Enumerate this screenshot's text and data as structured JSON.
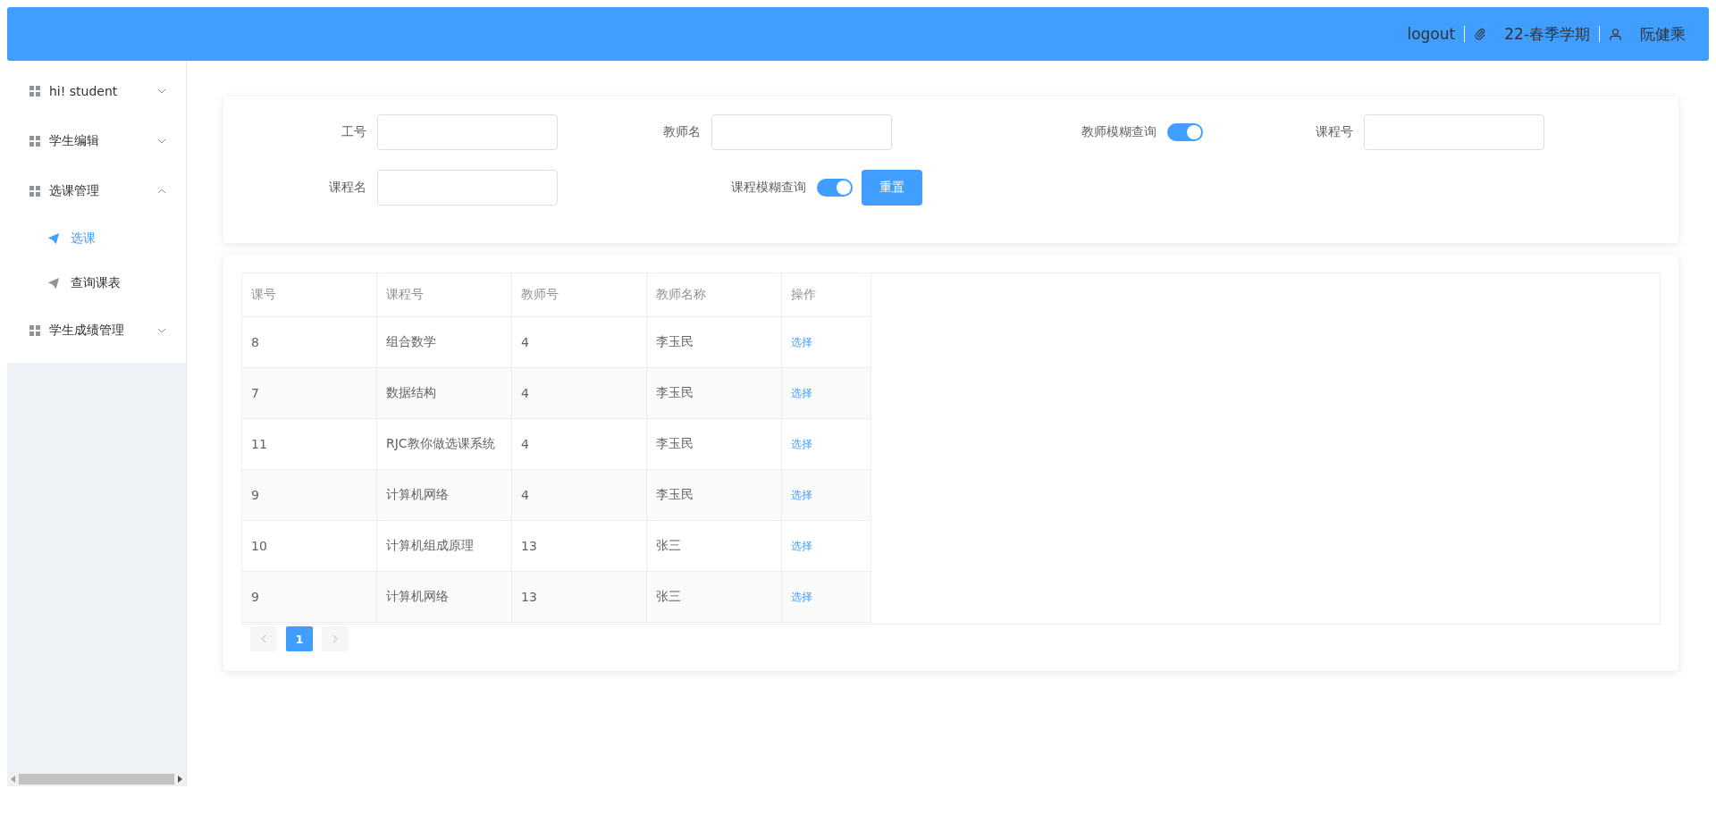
{
  "header": {
    "logout": "logout",
    "term": "22-春季学期",
    "user": "阮健乘"
  },
  "sidebar": {
    "groups": [
      {
        "label": "hi! student",
        "expanded": false
      },
      {
        "label": "学生编辑",
        "expanded": false
      },
      {
        "label": "选课管理",
        "expanded": true,
        "children": [
          {
            "label": "选课",
            "selected": true
          },
          {
            "label": "查询课表",
            "selected": false
          }
        ]
      },
      {
        "label": "学生成绩管理",
        "expanded": false
      }
    ]
  },
  "filters": [
    {
      "kind": "input",
      "label": "工号"
    },
    {
      "kind": "input",
      "label": "教师名"
    },
    {
      "kind": "switch",
      "label": "教师模糊查询",
      "on": true
    },
    {
      "kind": "input",
      "label": "课程号"
    },
    {
      "kind": "input",
      "label": "课程名"
    },
    {
      "kind": "switch",
      "label": "课程模糊查询",
      "on": true
    },
    {
      "kind": "button",
      "label": "重置"
    }
  ],
  "table": {
    "columns": [
      "课号",
      "课程号",
      "教师号",
      "教师名称",
      "操作"
    ],
    "rows": [
      [
        "8",
        "组合数学",
        "4",
        "李玉民",
        "选择"
      ],
      [
        "7",
        "数据结构",
        "4",
        "李玉民",
        "选择"
      ],
      [
        "11",
        "RJC教你做选课系统",
        "4",
        "李玉民",
        "选择"
      ],
      [
        "9",
        "计算机网络",
        "4",
        "李玉民",
        "选择"
      ],
      [
        "10",
        "计算机组成原理",
        "13",
        "张三",
        "选择"
      ],
      [
        "9",
        "计算机网络",
        "13",
        "张三",
        "选择"
      ]
    ]
  },
  "pagination": {
    "pages": [
      {
        "label": "1",
        "selected": true
      }
    ],
    "prev_disabled": true,
    "next_disabled": true
  }
}
